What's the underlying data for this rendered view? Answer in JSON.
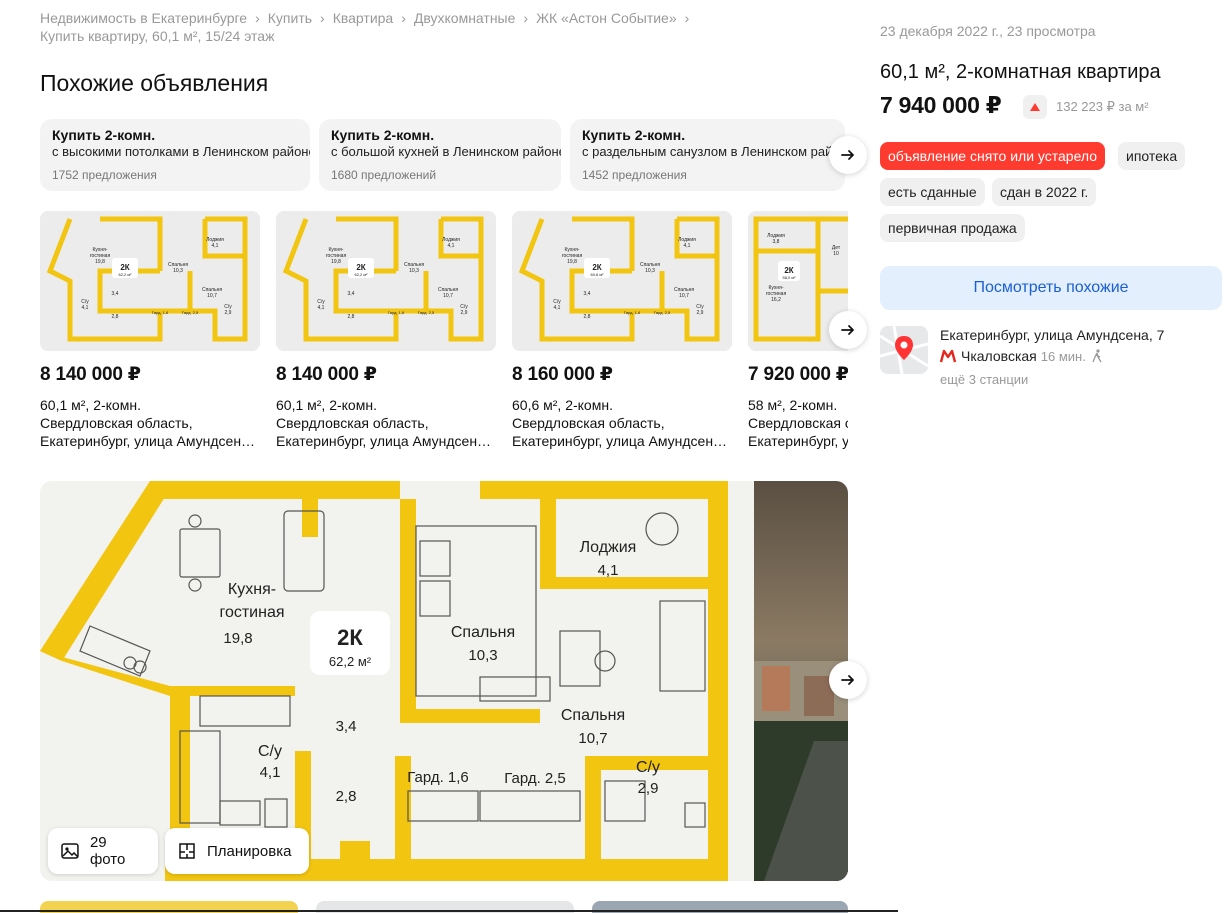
{
  "breadcrumb": {
    "items": [
      "Недвижимость в Екатеринбурге",
      "Купить",
      "Квартира",
      "Двухкомнатные",
      "ЖК «Астон Событие»",
      "Купить квартиру, 60,1 м², 15/24 этаж"
    ]
  },
  "similar": {
    "title": "Похожие объявления",
    "chips": [
      {
        "title": "Купить 2-комн.",
        "subtitle": "с высокими потолками в Ленинском районе",
        "count": "1752 предложения"
      },
      {
        "title": "Купить 2-комн.",
        "subtitle": "с большой кухней в Ленинском районе",
        "count": "1680 предложений"
      },
      {
        "title": "Купить 2-комн.",
        "subtitle": "с раздельным санузлом в Ленинском районе",
        "count": "1452 предложения"
      }
    ],
    "cards": [
      {
        "price": "8 140 000 ₽",
        "meta": "60,1 м², 2-комн.",
        "addr1": "Свердловская область,",
        "addr2": "Екатеринбург, улица Амундсен…"
      },
      {
        "price": "8 140 000 ₽",
        "meta": "60,1 м², 2-комн.",
        "addr1": "Свердловская область,",
        "addr2": "Екатеринбург, улица Амундсен…"
      },
      {
        "price": "8 160 000 ₽",
        "meta": "60,6 м², 2-комн.",
        "addr1": "Свердловская область,",
        "addr2": "Екатеринбург, улица Амундсен…"
      },
      {
        "price": "7 920 000 ₽",
        "meta": "58 м², 2-комн.",
        "addr1": "Свердловская область,",
        "addr2": "Екатеринбург, улица Амундсен…"
      }
    ]
  },
  "gallery": {
    "photos_label": "29 фото",
    "plan_label": "Планировка"
  },
  "plan": {
    "badge": "2К",
    "area": "62,2 м²",
    "rooms": {
      "kitchen": "Кухня-",
      "kitchen2": "гостиная",
      "kitchen_area": "19,8",
      "bed1": "Спальня",
      "bed1_area": "10,3",
      "loggia": "Лоджия",
      "loggia_area": "4,1",
      "bed2": "Спальня",
      "bed2_area": "10,7",
      "hall": "3,4",
      "hall2": "2,8",
      "bath1": "С/у",
      "bath1_area": "4,1",
      "gard1": "Гард. 1,6",
      "gard2": "Гард. 2,5",
      "bath2": "С/у",
      "bath2_area": "2,9"
    }
  },
  "thumbs": {
    "badge": "2К",
    "kitchen": "Кухня-",
    "kitchen2": "гостиная",
    "kitchen_area": "19,8",
    "bed1": "Спальня",
    "bed1_area": "10,3",
    "loggia": "Лоджия",
    "loggia_area": "4,1",
    "bed2": "Спальня",
    "bed2_area": "10,7",
    "bath": "С/у",
    "bath_area": "4,1",
    "gard1": "Гард. 1,6",
    "gard2": "Гард. 2,5",
    "bath2": "С/у",
    "bath2_area": "2,9",
    "hall": "3,4",
    "hall2": "2,8",
    "area_a": "62,2 м²",
    "area_b": "60,6 м²",
    "last_loggia": "Лоджия",
    "last_loggia_area": "3,8",
    "last_kitchen": "Кухня-",
    "last_kitchen2": "гостиная",
    "last_kitchen_area": "16,2",
    "last_area": "58,0 м²",
    "last_child": "Дет",
    "last_child_area": "10"
  },
  "offer": {
    "date_views": "23 декабря 2022 г., 23 просмотра",
    "title": "60,1 м², 2-комнатная квартира",
    "price": "7 940 000 ₽",
    "price_per_m2": "132 223 ₽ за м²",
    "tags": [
      "объявление снято или устарело",
      "ипотека",
      "есть сданные",
      "сдан в 2022 г.",
      "первичная продажа"
    ],
    "similar_button": "Посмотреть похожие",
    "address": "Екатеринбург, улица Амундсена, 7",
    "metro": "Чкаловская",
    "metro_time": "16 мин.",
    "more_stations": "ещё 3 станции"
  },
  "colors": {
    "accent_yellow": "#f2c511",
    "status_red": "#ff3b30",
    "metro_red": "#e4261c",
    "link_blue": "#1a5fd6"
  },
  "icons": [
    "arrow-right-icon",
    "photo-icon",
    "floorplan-icon",
    "map-pin-icon",
    "metro-icon",
    "walk-icon",
    "trend-up-icon"
  ]
}
